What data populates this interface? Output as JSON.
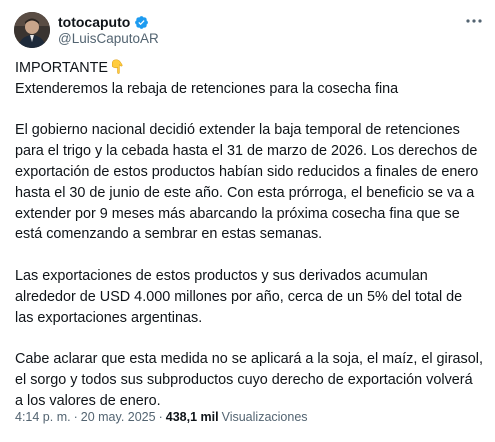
{
  "author": {
    "display_name": "totocaputo",
    "handle": "@LuisCaputoAR",
    "verified": true,
    "verified_color": "#1d9bf0"
  },
  "tweet": {
    "headline": "IMPORTANTE",
    "headline_emoji": "point-down-emoji",
    "subheadline": "Extenderemos la rebaja de retenciones para la cosecha fina",
    "paragraph_1_lines": [
      "El gobierno nacional decidió extender la baja temporal de retenciones",
      "para el trigo y la cebada hasta el 31 de marzo de 2026. Los derechos de",
      "exportación de estos productos habían sido reducidos a finales de enero",
      "hasta el 30 de junio de este año. Con esta prórroga, el beneficio se va a",
      "extender por 9 meses más abarcando la próxima cosecha fina que se",
      "está comenzando a sembrar en estas semanas."
    ],
    "paragraph_2_lines": [
      "Las exportaciones de estos productos y sus derivados acumulan",
      "alrededor de USD 4.000 millones por año, cerca de un 5% del total de",
      "las exportaciones argentinas."
    ],
    "paragraph_3_lines": [
      "Cabe aclarar que esta medida no se aplicará a la soja, el maíz, el girasol,",
      "el sorgo y todos sus subproductos cuyo derecho de exportación volverá",
      "a los valores de enero."
    ]
  },
  "meta": {
    "time": "4:14 p. m.",
    "separator": "·",
    "date": "20 may. 2025",
    "views_count": "438,1 mil",
    "views_label": "Visualizaciones"
  },
  "colors": {
    "text": "#0f1419",
    "secondary_text": "#536471",
    "accent": "#1d9bf0"
  }
}
